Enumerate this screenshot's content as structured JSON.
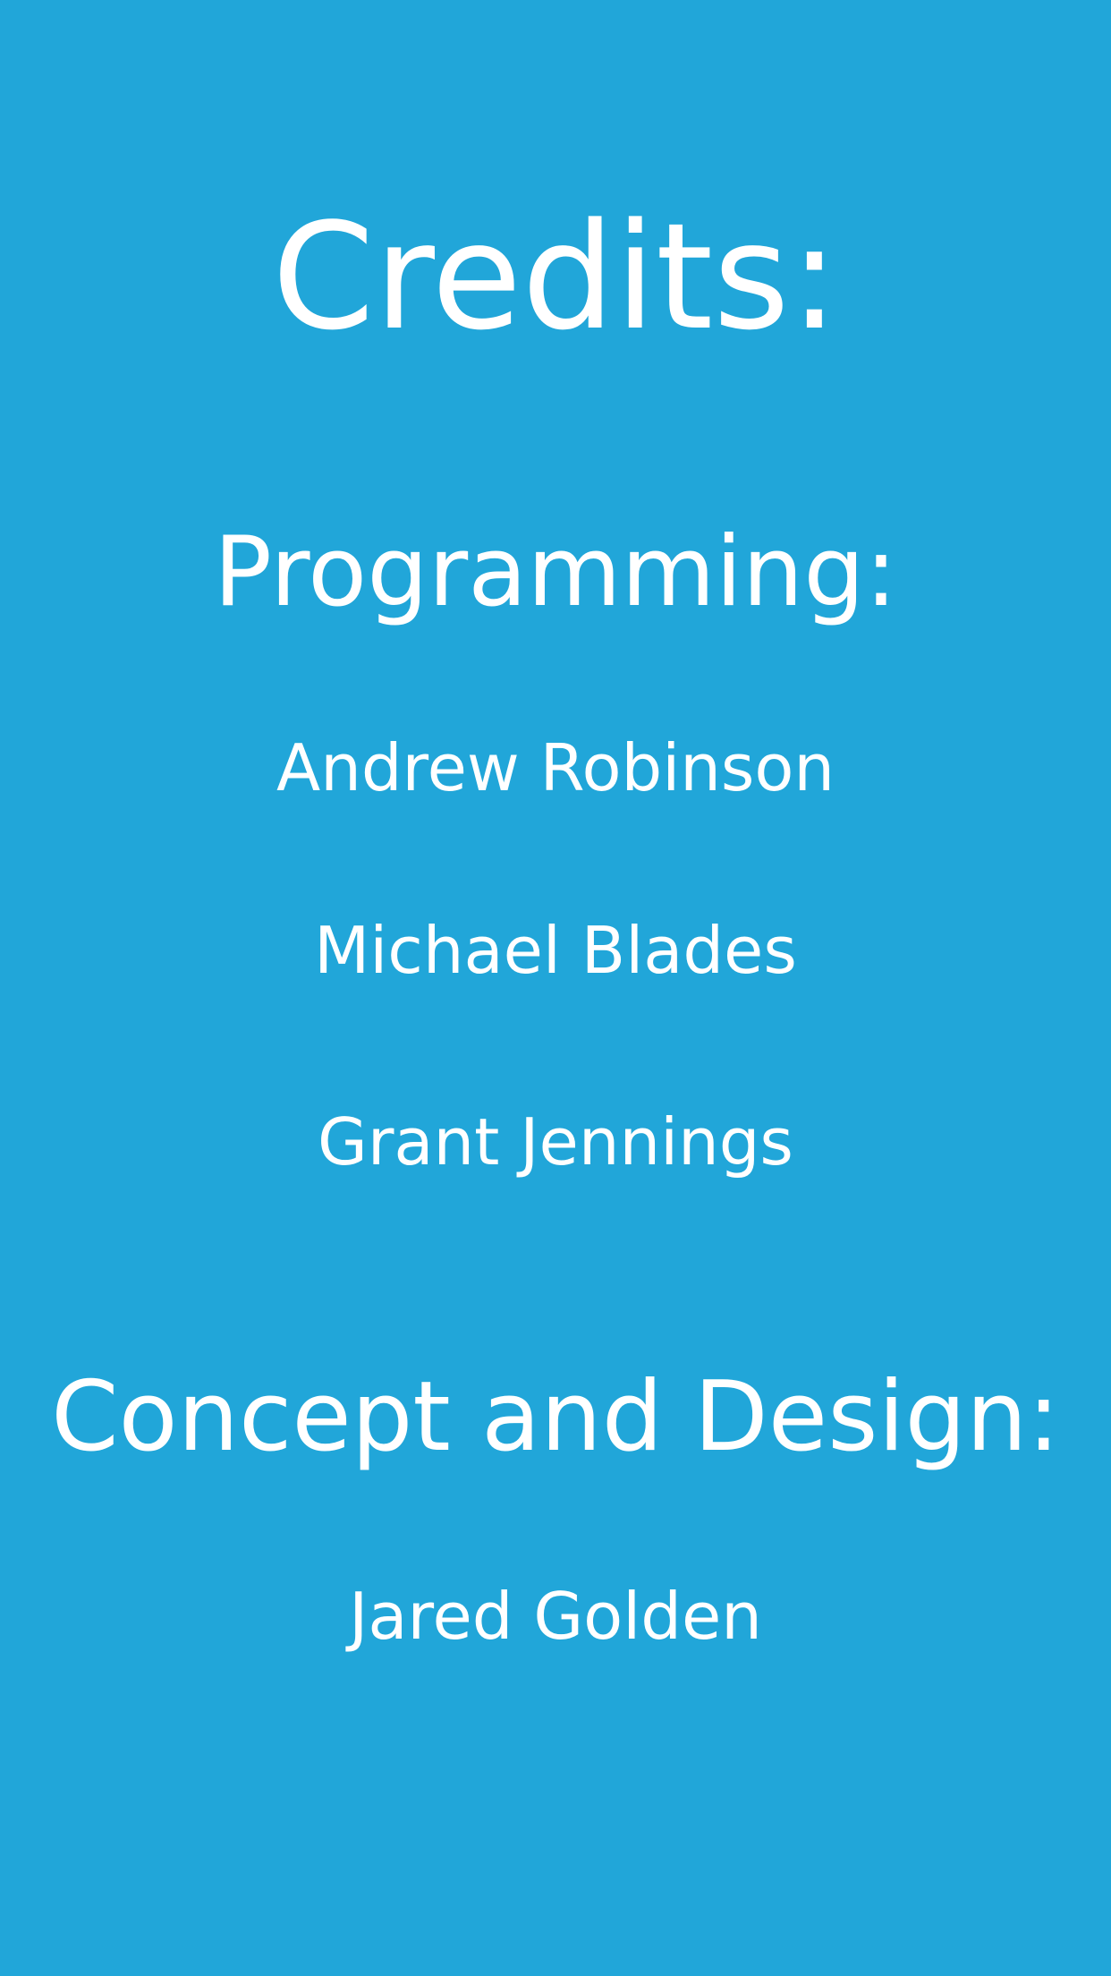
{
  "screen": {
    "background_color": "#21a6d9",
    "text_color": "#ffffff",
    "title": "Credits:",
    "sections": [
      {
        "heading": "Programming:",
        "names": [
          "Andrew Robinson",
          "Michael Blades",
          "Grant Jennings"
        ]
      },
      {
        "heading": "Concept and Design:",
        "names": [
          "Jared Golden"
        ]
      }
    ]
  }
}
